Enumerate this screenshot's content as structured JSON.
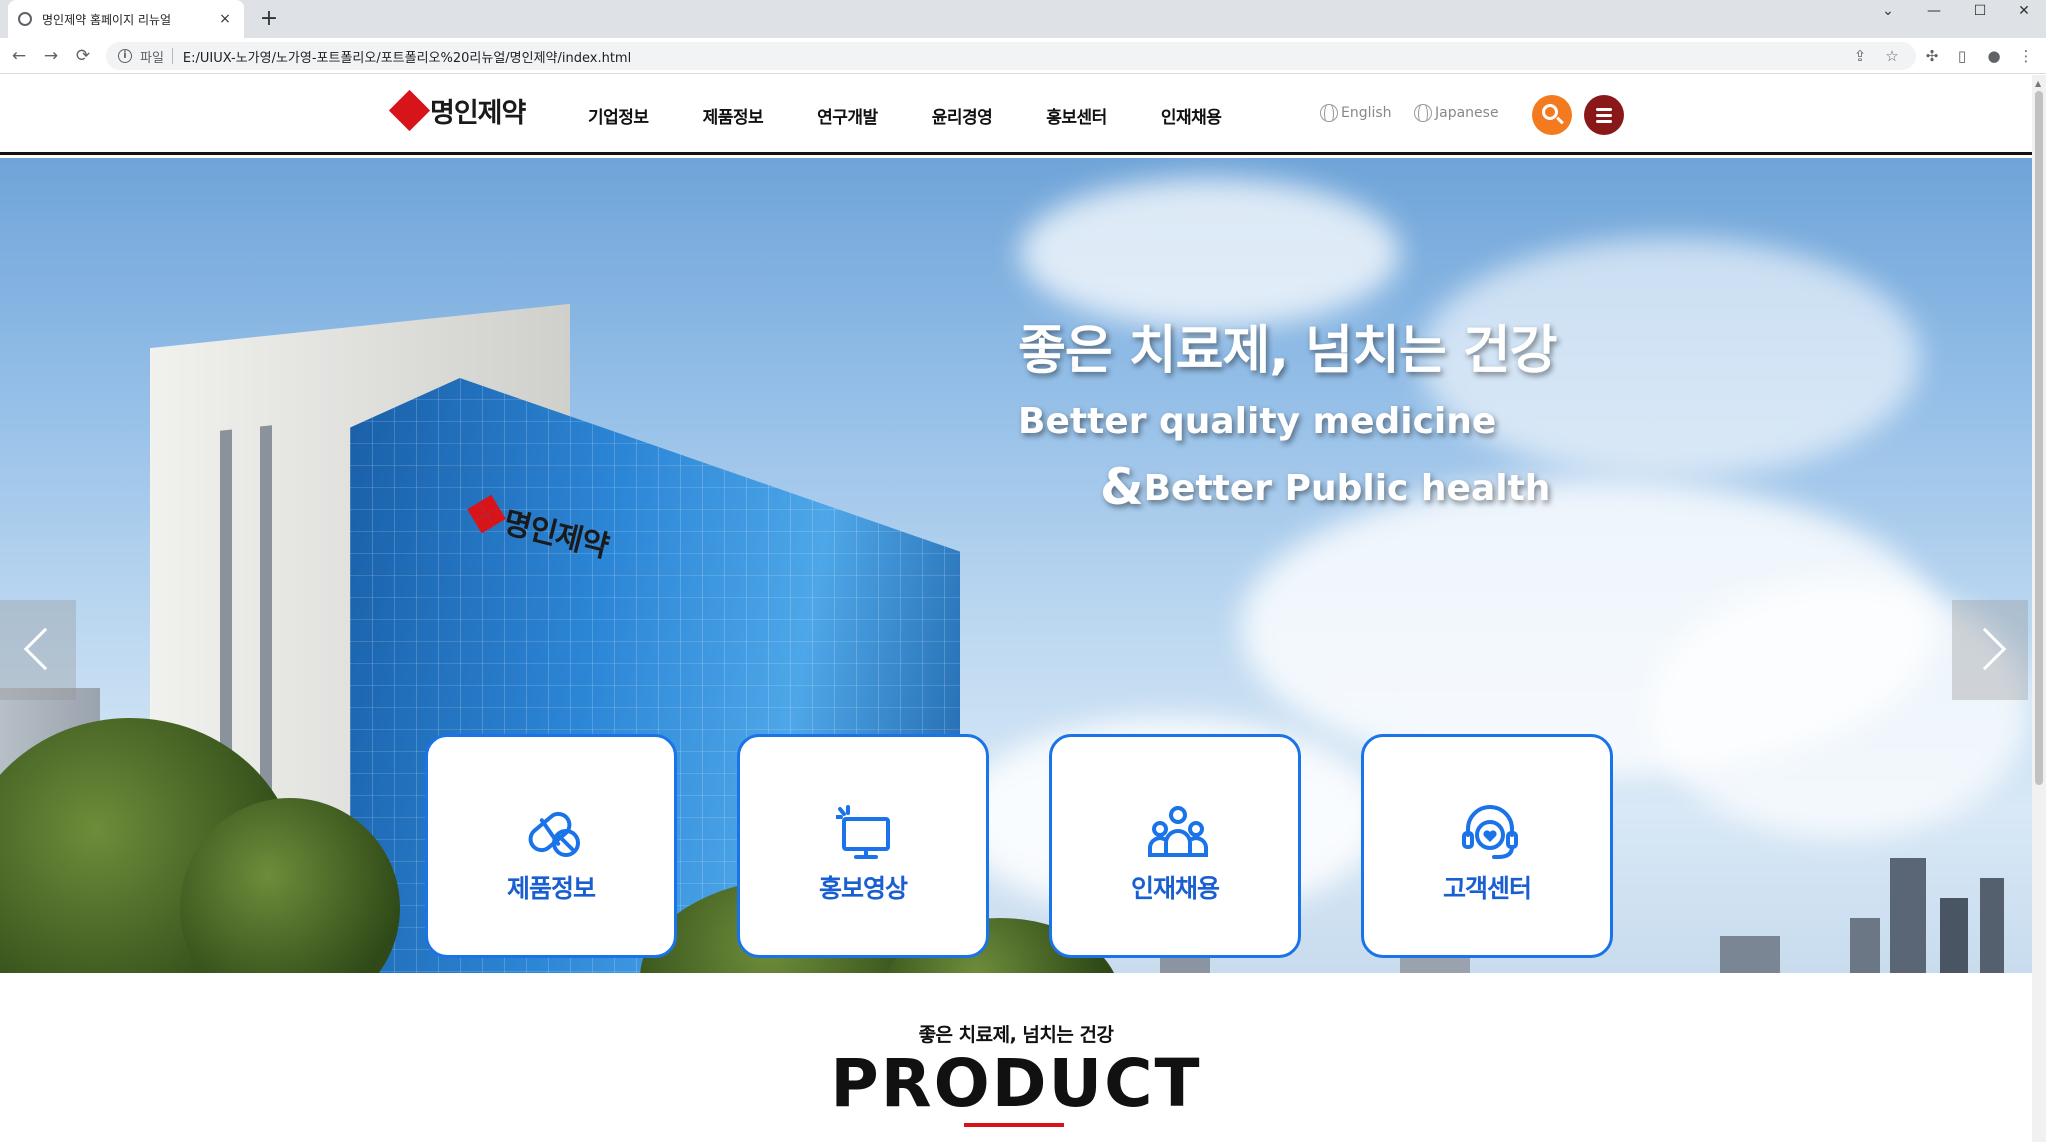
{
  "browser": {
    "tab_title": "명인제약 홈페이지 리뉴얼",
    "tab_close": "×",
    "new_tab": "+",
    "scheme_label": "파일",
    "url": "E:/UIUX-노가영/노가영-포트폴리오/포트폴리오%20리뉴얼/명인제약/index.html",
    "window_controls": [
      "⌄",
      "—",
      "☐",
      "✕"
    ],
    "nav_icons": [
      "←",
      "→",
      "⟳"
    ],
    "toolbar_icons": [
      "share-icon",
      "star-icon",
      "extension-icon",
      "sidepanel-icon",
      "profile-icon",
      "kebab-menu-icon"
    ]
  },
  "header": {
    "logo_text": "명인제약",
    "nav": [
      "기업정보",
      "제품정보",
      "연구개발",
      "윤리경영",
      "홍보센터",
      "인재채용"
    ],
    "lang": [
      "English",
      "Japanese"
    ],
    "colors": {
      "search": "#f47a20",
      "menu": "#8a1818",
      "brand_red": "#d7141a"
    }
  },
  "hero": {
    "headline": "좋은 치료제, 넘치는 건강",
    "line2": "Better quality medicine",
    "line3_amp": "&",
    "line3": "Better Public health",
    "building_sign": "명인제약",
    "quick_links": [
      {
        "label": "제품정보",
        "icon": "pill-icon"
      },
      {
        "label": "홍보영상",
        "icon": "monitor-icon"
      },
      {
        "label": "인재채용",
        "icon": "people-icon"
      },
      {
        "label": "고객센터",
        "icon": "headset-icon"
      }
    ],
    "slides": 3,
    "active_slide": 1,
    "accent_blue": "#1a73e8"
  },
  "product": {
    "subtitle": "좋은 치료제, 넘치는 건강",
    "title": "PRODUCT"
  }
}
